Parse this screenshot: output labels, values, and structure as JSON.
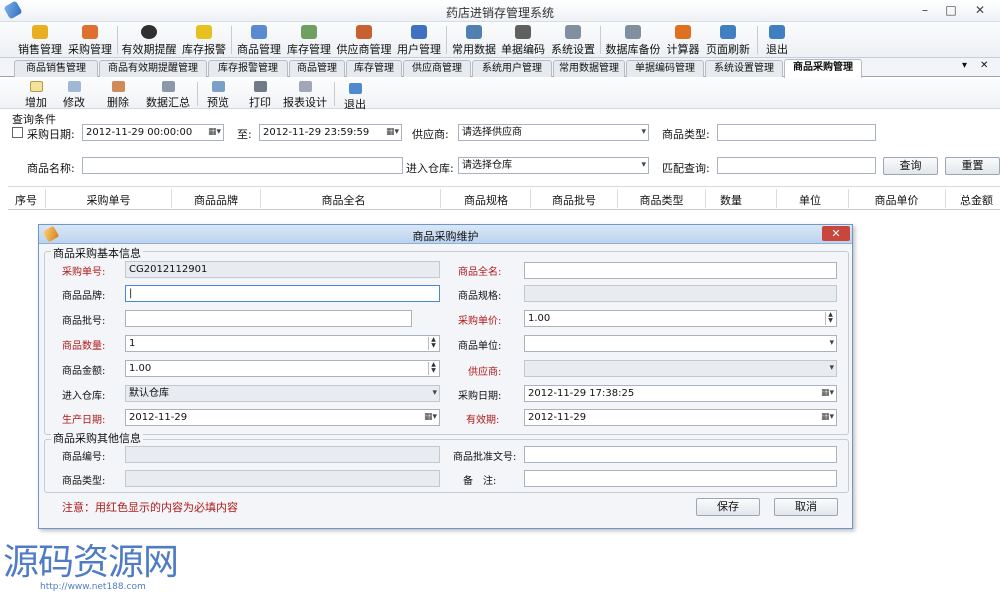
{
  "app": {
    "title": "药店进销存管理系统"
  },
  "window_controls": {
    "minimize": "–",
    "maximize": "□",
    "close": "✕"
  },
  "toolbar": {
    "items": [
      {
        "label": "销售管理",
        "icon": "money-bag-icon",
        "color": "#e8b020"
      },
      {
        "label": "采购管理",
        "icon": "shopping-icon",
        "color": "#e07030"
      },
      {
        "label": "有效期提醒",
        "icon": "clock-icon",
        "color": "#303030"
      },
      {
        "label": "库存报警",
        "icon": "warning-icon",
        "color": "#e8c020"
      },
      {
        "label": "商品管理",
        "icon": "pill-icon",
        "color": "#5a8ad0"
      },
      {
        "label": "库存管理",
        "icon": "inventory-icon",
        "color": "#70a060"
      },
      {
        "label": "供应商管理",
        "icon": "supplier-icon",
        "color": "#c86030"
      },
      {
        "label": "用户管理",
        "icon": "user-icon",
        "color": "#4070c0"
      },
      {
        "label": "常用数据",
        "icon": "database-icon",
        "color": "#5080b0"
      },
      {
        "label": "单据编码",
        "icon": "barcode-icon",
        "color": "#606060"
      },
      {
        "label": "系统设置",
        "icon": "settings-icon",
        "color": "#8090a0"
      },
      {
        "label": "数据库备份",
        "icon": "backup-icon",
        "color": "#8090a0"
      },
      {
        "label": "计算器",
        "icon": "calculator-icon",
        "color": "#e07020"
      },
      {
        "label": "页面刷新",
        "icon": "refresh-icon",
        "color": "#4080c0"
      },
      {
        "label": "退出",
        "icon": "exit-icon",
        "color": "#4080c0"
      }
    ]
  },
  "tabs": [
    {
      "label": "商品销售管理"
    },
    {
      "label": "商品有效期提醒管理"
    },
    {
      "label": "库存报警管理"
    },
    {
      "label": "商品管理"
    },
    {
      "label": "库存管理"
    },
    {
      "label": "供应商管理"
    },
    {
      "label": "系统用户管理"
    },
    {
      "label": "常用数据管理"
    },
    {
      "label": "单据编码管理"
    },
    {
      "label": "系统设置管理"
    },
    {
      "label": "商品采购管理",
      "active": true
    }
  ],
  "tab_controls": {
    "dropdown": "▾",
    "close": "✕"
  },
  "subtoolbar": {
    "items": [
      {
        "label": "增加",
        "icon": "add-icon"
      },
      {
        "label": "修改",
        "icon": "edit-icon"
      },
      {
        "label": "删除",
        "icon": "delete-icon"
      },
      {
        "label": "数据汇总",
        "icon": "summary-icon"
      },
      {
        "label": "预览",
        "icon": "preview-icon"
      },
      {
        "label": "打印",
        "icon": "print-icon"
      },
      {
        "label": "报表设计",
        "icon": "report-design-icon"
      },
      {
        "label": "退出",
        "icon": "exit-icon"
      }
    ]
  },
  "query": {
    "title": "查询条件",
    "purchase_date_label": "采购日期:",
    "date_from": "2012-11-29 00:00:00",
    "to_label": "至:",
    "date_to": "2012-11-29 23:59:59",
    "supplier_label": "供应商:",
    "supplier_value": "请选择供应商",
    "product_type_label": "商品类型:",
    "product_type_value": "",
    "product_name_label": "商品名称:",
    "product_name_value": "",
    "warehouse_label": "进入仓库:",
    "warehouse_value": "请选择仓库",
    "match_label": "匹配查询:",
    "match_value": "",
    "search_button": "查询",
    "reset_button": "重置"
  },
  "grid": {
    "columns": [
      "序号",
      "采购单号",
      "商品品牌",
      "商品全名",
      "商品规格",
      "商品批号",
      "商品类型",
      "数量",
      "单位",
      "商品单价",
      "总金额"
    ]
  },
  "dialog": {
    "title": "商品采购维护",
    "close": "✕",
    "basic_section": "商品采购基本信息",
    "other_section": "商品采购其他信息",
    "fields": {
      "purchase_no_label": "采购单号:",
      "purchase_no_value": "CG2012112901",
      "full_name_label": "商品全名:",
      "full_name_value": "",
      "brand_label": "商品品牌:",
      "brand_value": "|",
      "spec_label": "商品规格:",
      "spec_value": "",
      "batch_label": "商品批号:",
      "batch_value": "",
      "unit_price_label": "采购单价:",
      "unit_price_value": "1.00",
      "qty_label": "商品数量:",
      "qty_value": "1",
      "unit_label": "商品单位:",
      "unit_value": "",
      "amount_label": "商品金额:",
      "amount_value": "1.00",
      "supplier_label": "供应商:",
      "supplier_value": "",
      "warehouse_label": "进入仓库:",
      "warehouse_value": "默认仓库",
      "purchase_date_label": "采购日期:",
      "purchase_date_value": "2012-11-29 17:38:25",
      "prod_date_label": "生产日期:",
      "prod_date_value": "2012-11-29",
      "expiry_label": "有效期:",
      "expiry_value": "2012-11-29",
      "code_label": "商品编号:",
      "code_value": "",
      "approval_label": "商品批准文号:",
      "approval_value": "",
      "type_label": "商品类型:",
      "type_value": "",
      "remark_label": "备　注:",
      "remark_value": ""
    },
    "note": "注意：用红色显示的内容为必填内容",
    "save_button": "保存",
    "cancel_button": "取消"
  },
  "watermark": {
    "text": "源码资源网",
    "url": "http://www.net188.com"
  },
  "colors": {
    "required": "#b01a1a",
    "accent": "#4f7cc4"
  }
}
